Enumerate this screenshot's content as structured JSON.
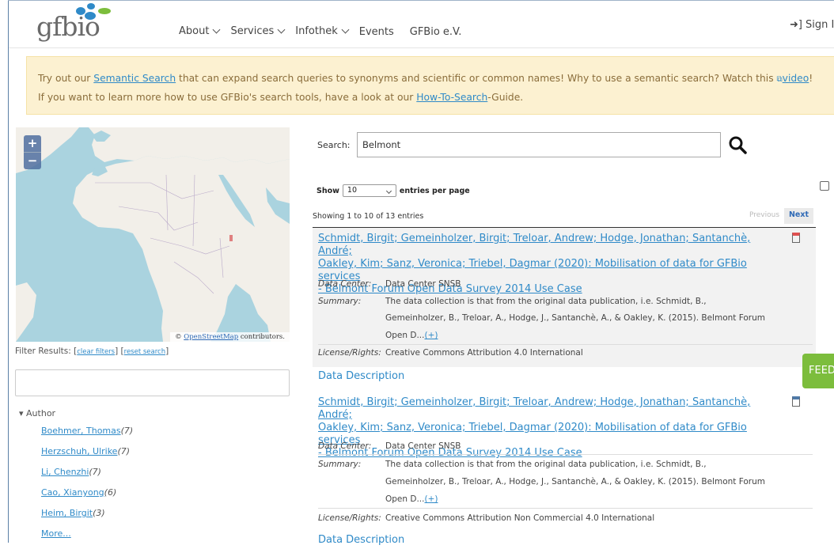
{
  "header": {
    "logo_text": "gfbio",
    "nav": [
      {
        "label": "About",
        "dropdown": true
      },
      {
        "label": "Services",
        "dropdown": true
      },
      {
        "label": "Infothek",
        "dropdown": true
      },
      {
        "label": "Events",
        "dropdown": false
      },
      {
        "label": "GFBio e.V.",
        "dropdown": false
      }
    ],
    "signin_label": "Sign In"
  },
  "notice": {
    "line1_pre": "Try out our ",
    "line1_link": "Semantic Search",
    "line1_mid": " that can expand search queries to synonyms and scientific or common names! Why to use a semantic search? Watch this ",
    "line1_video": "video",
    "line1_end": "!",
    "line2_pre": "If you want to learn more how to use GFBio's search tools, have a look at our ",
    "line2_link": "How-To-Search",
    "line2_end": "-Guide."
  },
  "map": {
    "zoom_in": "+",
    "zoom_out": "−",
    "attribution_pre": "© ",
    "attribution_link": "OpenStreetMap",
    "attribution_post": " contributors."
  },
  "filter": {
    "label": "Filter Results:",
    "clear_filters": "clear filters",
    "reset_search": "reset search",
    "input_value": ""
  },
  "facets": {
    "author_heading": "Author",
    "items": [
      {
        "name": "Boehmer, Thomas",
        "count": "(7)"
      },
      {
        "name": "Herzschuh, Ulrike",
        "count": "(7)"
      },
      {
        "name": "Li, Chenzhi",
        "count": "(7)"
      },
      {
        "name": "Cao, Xianyong",
        "count": "(6)"
      },
      {
        "name": "Heim, Birgit",
        "count": "(3)"
      },
      {
        "name": "More...",
        "count": ""
      }
    ]
  },
  "search": {
    "label": "Search:",
    "value": "Belmont",
    "show_label": "Show",
    "per_page": "10",
    "per_page_suffix": "entries per page",
    "info": "Showing 1 to 10 of 13 entries",
    "prev": "Previous",
    "next": "Next"
  },
  "results": [
    {
      "title_l1": "Schmidt, Birgit; Gemeinholzer, Birgit; Treloar, Andrew; Hodge, Jonathan; Santanchè, André;",
      "title_l2": "Oakley, Kim; Sanz, Veronica; Triebel, Dagmar (2020): Mobilisation of data for GFBio services",
      "title_l3": "- Belmont Forum Open Data Survey 2014 Use Case",
      "data_center_label": "Data Center:",
      "data_center": "Data Center SNSB",
      "summary_label": "Summary:",
      "summary_l1": "The data collection is that from the original data publication, i.e. Schmidt, B.,",
      "summary_l2": "Gemeinholzer, B., Treloar, A., Hodge, J., Santanchè, A., & Oakley, K. (2015). Belmont Forum",
      "summary_l3": "Open D...",
      "more": "(+)",
      "license_label": "License/Rights:",
      "license": "Creative Commons Attribution 4.0 International",
      "data_description": "Data Description"
    },
    {
      "title_l1": "Schmidt, Birgit; Gemeinholzer, Birgit; Treloar, Andrew; Hodge, Jonathan; Santanchè, André;",
      "title_l2": "Oakley, Kim; Sanz, Veronica; Triebel, Dagmar (2020): Mobilisation of data for GFBio services",
      "title_l3": "- Belmont Forum Open Data Survey 2014 Use Case",
      "data_center_label": "Data Center:",
      "data_center": "Data Center SNSB",
      "summary_label": "Summary:",
      "summary_l1": "The data collection is that from the original data publication, i.e. Schmidt, B.,",
      "summary_l2": "Gemeinholzer, B., Treloar, A., Hodge, J., Santanchè, A., & Oakley, K. (2015). Belmont Forum",
      "summary_l3": "Open D...",
      "more": "(+)",
      "license_label": "License/Rights:",
      "license": "Creative Commons Attribution Non Commercial 4.0 International",
      "data_description": "Data Description"
    }
  ],
  "feedback_label": "FEEDBACK",
  "colors": {
    "link": "#2f8ac8",
    "notice_bg": "#fcf1d1",
    "feedback": "#7cbd3c",
    "bookmark_red": "#e05050",
    "bookmark_blue": "#4f7aa8"
  }
}
